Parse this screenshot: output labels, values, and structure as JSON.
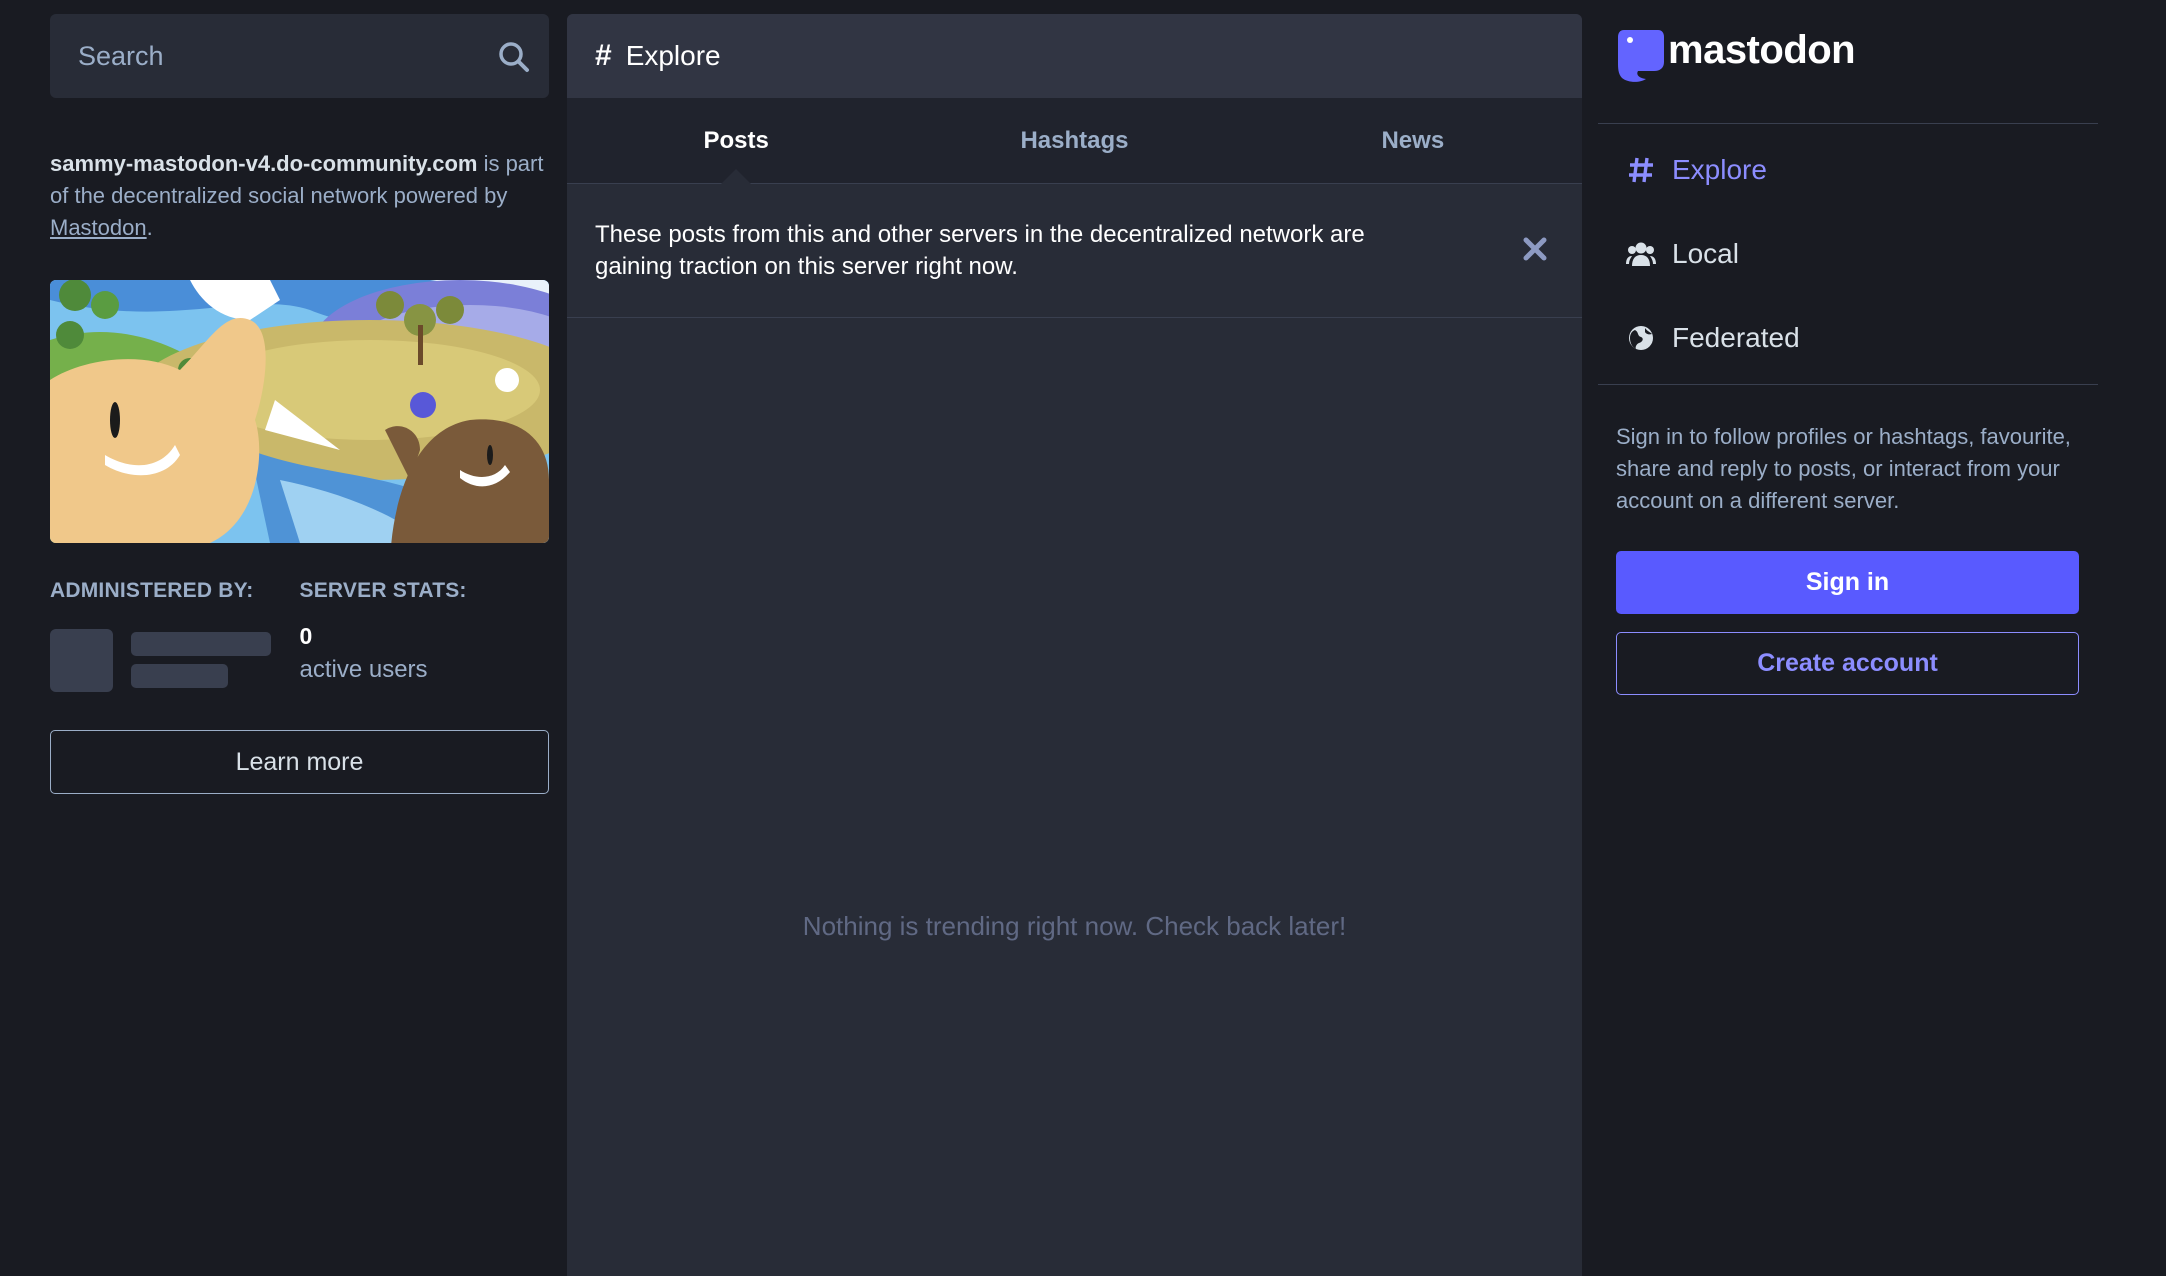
{
  "search": {
    "placeholder": "Search",
    "icon": "search-icon"
  },
  "server": {
    "domain": "sammy-mastodon-v4.do-community.com",
    "desc_after_domain": " is part of the decentralized social network powered by ",
    "link_text": "Mastodon",
    "desc_end": ".",
    "hero_image": "mastodon-elephants-illustration"
  },
  "admin": {
    "heading": "ADMINISTERED BY:"
  },
  "stats": {
    "heading": "SERVER STATS:",
    "active_users": "0",
    "active_users_label": "active users"
  },
  "learn_more_label": "Learn more",
  "column": {
    "icon": "#",
    "title": "Explore",
    "tabs": [
      {
        "label": "Posts",
        "active": true
      },
      {
        "label": "Hashtags",
        "active": false
      },
      {
        "label": "News",
        "active": false
      }
    ],
    "notice": "These posts from this and other servers in the decentralized network are gaining traction on this server right now.",
    "empty_message": "Nothing is trending right now. Check back later!"
  },
  "brand": {
    "name": "mastodon"
  },
  "nav": [
    {
      "label": "Explore",
      "icon": "hashtag-icon",
      "active": true
    },
    {
      "label": "Local",
      "icon": "users-icon",
      "active": false
    },
    {
      "label": "Federated",
      "icon": "globe-icon",
      "active": false
    }
  ],
  "signin": {
    "text": "Sign in to follow profiles or hashtags, favourite, share and reply to posts, or interact from your account on a different server.",
    "signin_label": "Sign in",
    "create_label": "Create account"
  },
  "colors": {
    "background": "#191b22",
    "column_bg": "#282c37",
    "accent": "#595aff",
    "accent_text": "#8c8dff"
  }
}
